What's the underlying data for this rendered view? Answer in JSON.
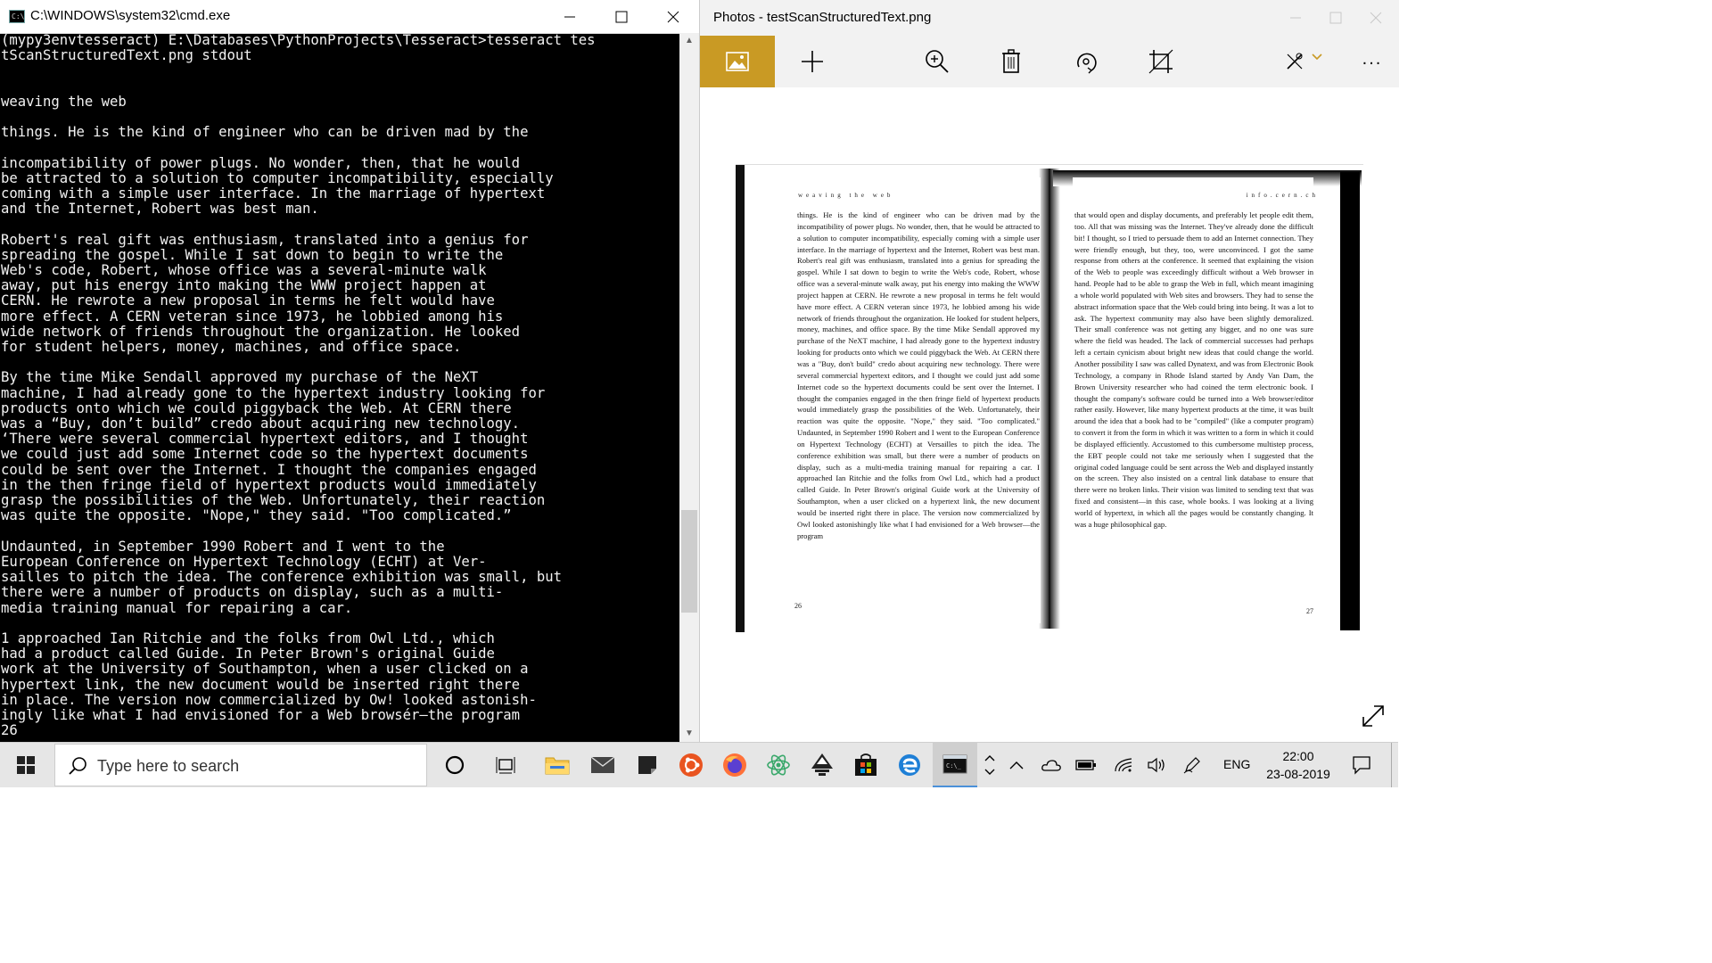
{
  "cmd": {
    "title": "C:\\WINDOWS\\system32\\cmd.exe",
    "icon_text": "C:\\",
    "lines": [
      "(mypy3envtesseract) E:\\Databases\\PythonProjects\\Tesseract>tesseract tes",
      "tScanStructuredText.png stdout",
      "",
      "",
      "weaving the web",
      "",
      "things. He is the kind of engineer who can be driven mad by the",
      "",
      "incompatibility of power plugs. No wonder, then, that he would",
      "be attracted to a solution to computer incompatibility, especially",
      "coming with a simple user interface. In the marriage of hypertext",
      "and the Internet, Robert was best man.",
      "",
      "Robert's real gift was enthusiasm, translated into a genius for",
      "spreading the gospel. While I sat down to begin to write the",
      "Web's code, Robert, whose office was a several-minute walk",
      "away, put his energy into making the WWW project happen at",
      "CERN. He rewrote a new proposal in terms he felt would have",
      "more effect. A CERN veteran since 1973, he lobbied among his",
      "wide network of friends throughout the organization. He looked",
      "for student helpers, money, machines, and office space.",
      "",
      "By the time Mike Sendall approved my purchase of the NeXT",
      "machine, I had already gone to the hypertext industry looking for",
      "products onto which we could piggyback the Web. At CERN there",
      "was a “Buy, don’t build” credo about acquiring new technology.",
      "‘There were several commercial hypertext editors, and I thought",
      "we could just add some Internet code so the hypertext documents",
      "could be sent over the Internet. I thought the companies engaged",
      "in the then fringe field of hypertext products would immediately",
      "grasp the possibilities of the Web. Unfortunately, their reaction",
      "was quite the opposite. \"Nope,\" they said. \"Too complicated.”",
      "",
      "Undaunted, in September 1990 Robert and I went to the",
      "European Conference on Hypertext Technology (ECHT) at Ver-",
      "sailles to pitch the idea. The conference exhibition was small, but",
      "there were a number of products on display, such as a multi-",
      "media training manual for repairing a car.",
      "",
      "1 approached Ian Ritchie and the folks from Owl Ltd., which",
      "had a product called Guide. In Peter Brown's original Guide",
      "work at the University of Southampton, when a user clicked on a",
      "hypertext link, the new document would be inserted right there",
      "in place. The version now commercialized by Ow! looked astonish-",
      "ingly like what I had envisioned for a Web browsér—the program",
      "26"
    ]
  },
  "photos": {
    "title": "Photos - testScanStructuredText.png",
    "toolbar_icons": [
      "photo-icon",
      "add-icon",
      "zoom-icon",
      "delete-icon",
      "rotate-icon",
      "crop-icon",
      "edit-icon",
      "more-icon"
    ],
    "more_label": "...",
    "accent": "#c99a24",
    "scan": {
      "left_runhead": "weaving the web",
      "right_runhead": "info.cern.ch",
      "left_folio": "26",
      "right_folio": "27",
      "left_text": "things. He is the kind of engineer who can be driven mad by the incompatibility of power plugs. No wonder, then, that he would be attracted to a solution to computer incompatibility, especially coming with a simple user interface. In the marriage of hypertext and the Internet, Robert was best man. Robert's real gift was enthusiasm, translated into a genius for spreading the gospel. While I sat down to begin to write the Web's code, Robert, whose office was a several-minute walk away, put his energy into making the WWW project happen at CERN. He rewrote a new proposal in terms he felt would have more effect. A CERN veteran since 1973, he lobbied among his wide network of friends throughout the organization. He looked for student helpers, money, machines, and office space. By the time Mike Sendall approved my purchase of the NeXT machine, I had already gone to the hypertext industry looking for products onto which we could piggyback the Web. At CERN there was a \"Buy, don't build\" credo about acquiring new technology. There were several commercial hypertext editors, and I thought we could just add some Internet code so the hypertext documents could be sent over the Internet. I thought the companies engaged in the then fringe field of hypertext products would immediately grasp the possibilities of the Web. Unfortunately, their reaction was quite the opposite. \"Nope,\" they said. \"Too complicated.\" Undaunted, in September 1990 Robert and I went to the European Conference on Hypertext Technology (ECHT) at Versailles to pitch the idea. The conference exhibition was small, but there were a number of products on display, such as a multi-media training manual for repairing a car. I approached Ian Ritchie and the folks from Owl Ltd., which had a product called Guide. In Peter Brown's original Guide work at the University of Southampton, when a user clicked on a hypertext link, the new document would be inserted right there in place. The version now commercialized by Owl looked astonishingly like what I had envisioned for a Web browser—the program",
      "right_text": "that would open and display documents, and preferably let people edit them, too. All that was missing was the Internet. They've already done the difficult bit! I thought, so I tried to persuade them to add an Internet connection. They were friendly enough, but they, too, were unconvinced. I got the same response from others at the conference. It seemed that explaining the vision of the Web to people was exceedingly difficult without a Web browser in hand. People had to be able to grasp the Web in full, which meant imagining a whole world populated with Web sites and browsers. They had to sense the abstract information space that the Web could bring into being. It was a lot to ask. The hypertext community may also have been slightly demoralized. Their small conference was not getting any bigger, and no one was sure where the field was headed. The lack of commercial successes had perhaps left a certain cynicism about bright new ideas that could change the world. Another possibility I saw was called Dynatext, and was from Electronic Book Technology, a company in Rhode Island started by Andy Van Dam, the Brown University researcher who had coined the term electronic book. I thought the company's software could be turned into a Web browser/editor rather easily. However, like many hypertext products at the time, it was built around the idea that a book had to be \"compiled\" (like a computer program) to convert it from the form in which it was written to a form in which it could be displayed efficiently. Accustomed to this cumbersome multistep process, the EBT people could not take me seriously when I suggested that the original coded language could be sent across the Web and displayed instantly on the screen. They also insisted on a central link database to ensure that there were no broken links. Their vision was limited to sending text that was fixed and consistent—in this case, whole books. I was looking at a living world of hypertext, in which all the pages would be constantly changing. It was a huge philosophical gap."
    }
  },
  "taskbar": {
    "search_placeholder": "Type here to search",
    "language": "ENG",
    "time": "22:00",
    "date": "23-08-2019"
  }
}
